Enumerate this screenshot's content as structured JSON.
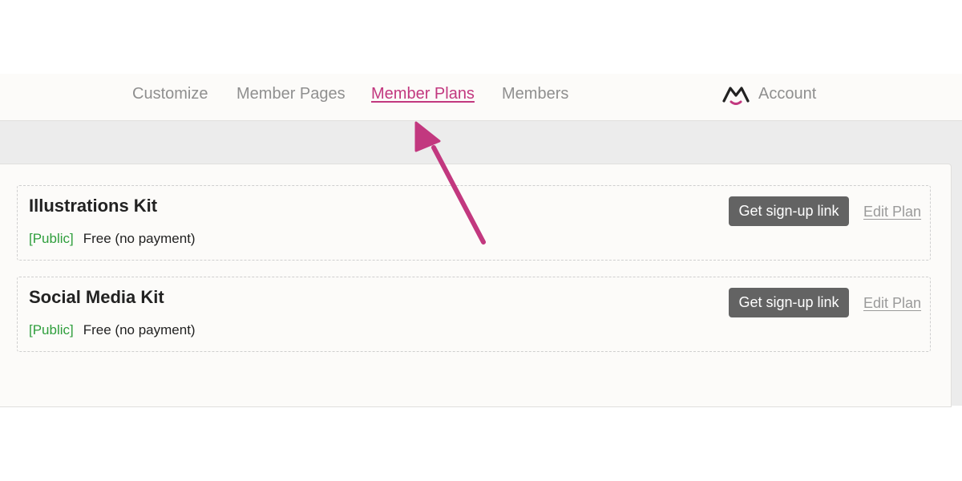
{
  "nav": {
    "items": [
      {
        "label": "Customize",
        "active": false
      },
      {
        "label": "Member Pages",
        "active": false
      },
      {
        "label": "Member Plans",
        "active": true
      },
      {
        "label": "Members",
        "active": false
      }
    ],
    "account_label": "Account",
    "active_color": "#c2387f"
  },
  "plans": [
    {
      "title": "Illustrations Kit",
      "visibility": "[Public]",
      "price": "Free (no payment)",
      "signup_label": "Get sign-up link",
      "edit_label": "Edit Plan"
    },
    {
      "title": "Social Media Kit",
      "visibility": "[Public]",
      "price": "Free (no payment)",
      "signup_label": "Get sign-up link",
      "edit_label": "Edit Plan"
    }
  ],
  "annotation": {
    "icon": "arrow-up-left-icon",
    "color": "#c2387f"
  },
  "colors": {
    "public_green": "#2e9e3c",
    "button_gray": "#636363"
  }
}
